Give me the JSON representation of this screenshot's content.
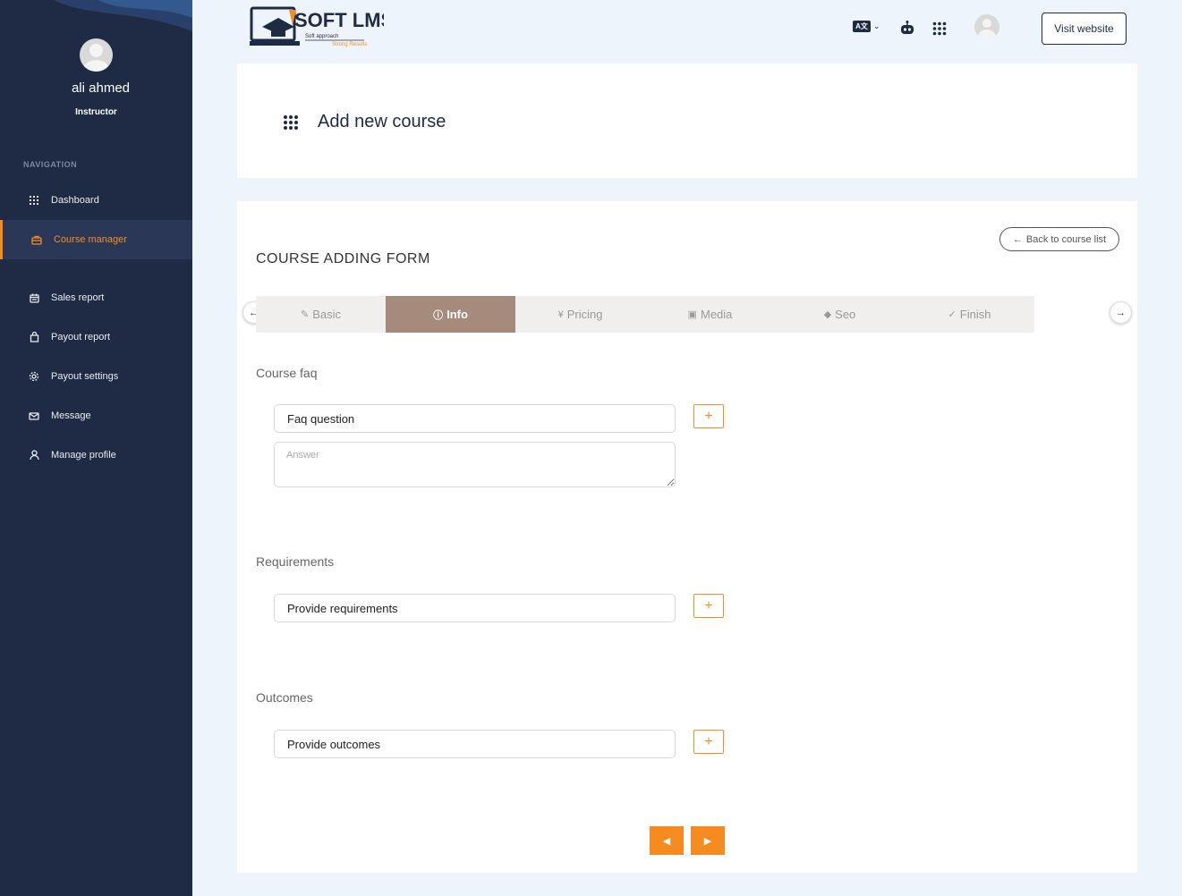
{
  "sidebar": {
    "user_name": "ali ahmed",
    "user_role": "Instructor",
    "nav_heading": "NAVIGATION",
    "items": [
      {
        "label": "Dashboard",
        "icon": "grid-icon"
      },
      {
        "label": "Course manager",
        "icon": "briefcase-icon"
      },
      {
        "label": "Sales report",
        "icon": "calendar-icon"
      },
      {
        "label": "Payout report",
        "icon": "bag-icon"
      },
      {
        "label": "Payout settings",
        "icon": "gear-icon"
      },
      {
        "label": "Message",
        "icon": "envelope-icon"
      },
      {
        "label": "Manage profile",
        "icon": "user-icon"
      }
    ],
    "active_item": "Course manager"
  },
  "header": {
    "logo_text": "SOFT LMS",
    "logo_tagline_1": "Soft approach",
    "logo_tagline_2": "Strong Results",
    "lang_badge": "A文",
    "visit_label": "Visit website"
  },
  "page": {
    "title": "Add new course"
  },
  "form": {
    "heading": "COURSE ADDING FORM",
    "back_label": "Back to course list",
    "tabs": [
      {
        "label": "Basic",
        "icon": "pen-icon"
      },
      {
        "label": "Info",
        "icon": "info-icon"
      },
      {
        "label": "Pricing",
        "icon": "yen-icon"
      },
      {
        "label": "Media",
        "icon": "media-icon"
      },
      {
        "label": "Seo",
        "icon": "tag-icon"
      },
      {
        "label": "Finish",
        "icon": "check-circle-icon"
      }
    ],
    "active_tab": "Info",
    "faq": {
      "label": "Course faq",
      "question_placeholder": "Faq question",
      "answer_placeholder": "Answer"
    },
    "requirements": {
      "label": "Requirements",
      "placeholder": "Provide requirements"
    },
    "outcomes": {
      "label": "Outcomes",
      "placeholder": "Provide outcomes"
    },
    "plus_symbol": "+"
  },
  "colors": {
    "sidebar_bg": "#1f2b45",
    "accent": "#f68c1f",
    "active_tab_bg": "#a68b7c",
    "page_bg": "#eef4fb"
  }
}
